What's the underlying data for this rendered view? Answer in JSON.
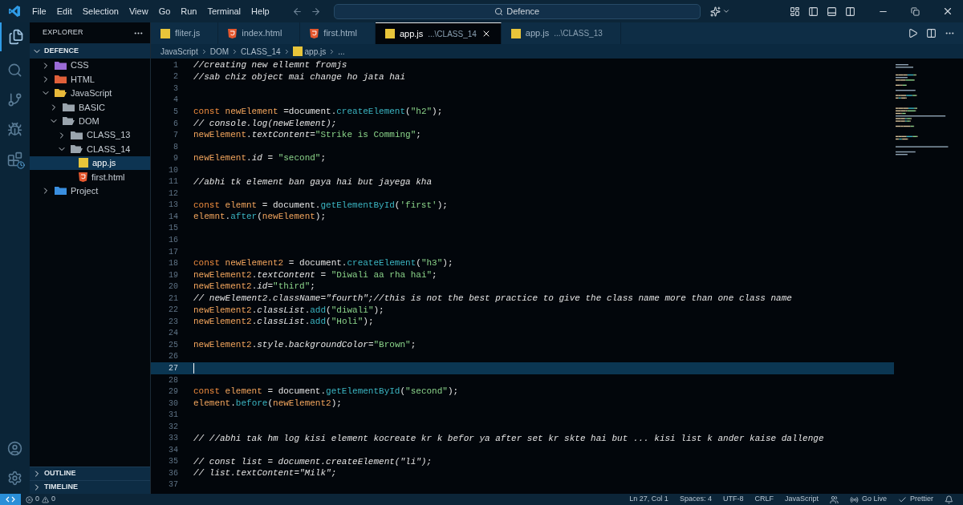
{
  "menu": [
    "File",
    "Edit",
    "Selection",
    "View",
    "Go",
    "Run",
    "Terminal",
    "Help"
  ],
  "search": {
    "value": "Defence"
  },
  "sidebar": {
    "title": "EXPLORER",
    "section": {
      "label": "DEFENCE",
      "expanded": true
    },
    "tree": [
      {
        "label": "CSS",
        "kind": "folder",
        "color": "#9b6bd6",
        "expanded": false,
        "selected": false
      },
      {
        "label": "HTML",
        "kind": "folder",
        "color": "#e0603a",
        "expanded": false,
        "selected": false
      },
      {
        "label": "JavaScript",
        "kind": "folder",
        "color": "#e8b93a",
        "expanded": true,
        "selected": false,
        "children": [
          {
            "label": "BASIC",
            "kind": "folder",
            "color": "#9aa4ad",
            "expanded": false,
            "selected": false
          },
          {
            "label": "DOM",
            "kind": "folder",
            "color": "#9aa4ad",
            "expanded": true,
            "selected": false,
            "children": [
              {
                "label": "CLASS_13",
                "kind": "folder",
                "color": "#9aa4ad",
                "expanded": false,
                "selected": false
              },
              {
                "label": "CLASS_14",
                "kind": "folder",
                "color": "#9aa4ad",
                "expanded": true,
                "selected": false,
                "children": [
                  {
                    "label": "app.js",
                    "kind": "js",
                    "selected": true
                  },
                  {
                    "label": "first.html",
                    "kind": "html",
                    "selected": false
                  }
                ]
              }
            ]
          }
        ]
      },
      {
        "label": "Project",
        "kind": "folder",
        "color": "#3a8fe0",
        "expanded": false,
        "selected": false
      }
    ],
    "panels": [
      {
        "label": "OUTLINE",
        "expanded": false
      },
      {
        "label": "TIMELINE",
        "expanded": false
      }
    ]
  },
  "tabs": [
    {
      "name": "fliter.js",
      "kind": "js",
      "selected": false
    },
    {
      "name": "index.html",
      "kind": "html",
      "selected": false
    },
    {
      "name": "first.html",
      "kind": "html",
      "selected": false
    },
    {
      "name": "app.js",
      "description": "...\\CLASS_14",
      "kind": "js",
      "selected": true
    },
    {
      "name": "app.js",
      "description": "...\\CLASS_13",
      "kind": "js",
      "selected": false
    }
  ],
  "breadcrumb": [
    {
      "label": "JavaScript",
      "kind": "text"
    },
    {
      "label": "DOM",
      "kind": "text"
    },
    {
      "label": "CLASS_14",
      "kind": "text"
    },
    {
      "label": "app.js",
      "kind": "js"
    },
    {
      "label": "...",
      "kind": "text"
    }
  ],
  "editor": {
    "lines": [
      {
        "number": "1",
        "current": false,
        "tokens": [
          {
            "kind": "c",
            "text": "//creating new ellemnt fromjs"
          }
        ]
      },
      {
        "number": "2",
        "current": false,
        "tokens": [
          {
            "kind": "c",
            "text": "//sab chiz object mai change ho jata hai"
          }
        ]
      },
      {
        "number": "3",
        "current": false
      },
      {
        "number": "4",
        "current": false
      },
      {
        "number": "5",
        "current": false,
        "tokens": [
          {
            "kind": "k",
            "text": "const "
          },
          {
            "kind": "v",
            "text": "newElement "
          },
          {
            "kind": "p",
            "text": "=document."
          },
          {
            "kind": "m",
            "text": "createElement"
          },
          {
            "kind": "p",
            "text": "("
          },
          {
            "kind": "s",
            "text": "\"h2\""
          },
          {
            "kind": "p",
            "text": ");"
          }
        ]
      },
      {
        "number": "6",
        "current": false,
        "tokens": [
          {
            "kind": "c",
            "text": "// console.log(newElement);"
          }
        ]
      },
      {
        "number": "7",
        "current": false,
        "tokens": [
          {
            "kind": "v",
            "text": "newElement"
          },
          {
            "kind": "p",
            "text": "."
          },
          {
            "kind": "i",
            "text": "textContent"
          },
          {
            "kind": "p",
            "text": "="
          },
          {
            "kind": "s",
            "text": "\"Strike is Comming\""
          },
          {
            "kind": "p",
            "text": ";"
          }
        ]
      },
      {
        "number": "8",
        "current": false
      },
      {
        "number": "9",
        "current": false,
        "tokens": [
          {
            "kind": "v",
            "text": "newElement"
          },
          {
            "kind": "p",
            "text": "."
          },
          {
            "kind": "i",
            "text": "id"
          },
          {
            "kind": "p",
            "text": " = "
          },
          {
            "kind": "s",
            "text": "\"second\""
          },
          {
            "kind": "p",
            "text": ";"
          }
        ]
      },
      {
        "number": "10",
        "current": false
      },
      {
        "number": "11",
        "current": false,
        "tokens": [
          {
            "kind": "c",
            "text": "//abhi tk element ban gaya hai but jayega kha"
          }
        ]
      },
      {
        "number": "12",
        "current": false
      },
      {
        "number": "13",
        "current": false,
        "tokens": [
          {
            "kind": "k",
            "text": "const "
          },
          {
            "kind": "v",
            "text": "elemnt"
          },
          {
            "kind": "p",
            "text": " = document."
          },
          {
            "kind": "m",
            "text": "getElementById"
          },
          {
            "kind": "p",
            "text": "("
          },
          {
            "kind": "s",
            "text": "'first'"
          },
          {
            "kind": "p",
            "text": ");"
          }
        ]
      },
      {
        "number": "14",
        "current": false,
        "tokens": [
          {
            "kind": "v",
            "text": "elemnt"
          },
          {
            "kind": "p",
            "text": "."
          },
          {
            "kind": "m",
            "text": "after"
          },
          {
            "kind": "p",
            "text": "("
          },
          {
            "kind": "v",
            "text": "newElement"
          },
          {
            "kind": "p",
            "text": ");"
          }
        ]
      },
      {
        "number": "15",
        "current": false
      },
      {
        "number": "16",
        "current": false
      },
      {
        "number": "17",
        "current": false
      },
      {
        "number": "18",
        "current": false,
        "tokens": [
          {
            "kind": "k",
            "text": "const "
          },
          {
            "kind": "v",
            "text": "newElement2"
          },
          {
            "kind": "p",
            "text": " = document."
          },
          {
            "kind": "m",
            "text": "createElement"
          },
          {
            "kind": "p",
            "text": "("
          },
          {
            "kind": "s",
            "text": "\"h3\""
          },
          {
            "kind": "p",
            "text": ");"
          }
        ]
      },
      {
        "number": "19",
        "current": false,
        "tokens": [
          {
            "kind": "v",
            "text": "newElement2"
          },
          {
            "kind": "p",
            "text": "."
          },
          {
            "kind": "i",
            "text": "textContent"
          },
          {
            "kind": "p",
            "text": " = "
          },
          {
            "kind": "s",
            "text": "\"Diwali aa rha hai\""
          },
          {
            "kind": "p",
            "text": ";"
          }
        ]
      },
      {
        "number": "20",
        "current": false,
        "tokens": [
          {
            "kind": "v",
            "text": "newElement2"
          },
          {
            "kind": "p",
            "text": "."
          },
          {
            "kind": "i",
            "text": "id"
          },
          {
            "kind": "p",
            "text": "="
          },
          {
            "kind": "s",
            "text": "\"third\""
          },
          {
            "kind": "p",
            "text": ";"
          }
        ]
      },
      {
        "number": "21",
        "current": false,
        "tokens": [
          {
            "kind": "c",
            "text": "// newElement2.className=\"fourth\";//this is not the best practice to give the class name more than one class name"
          }
        ]
      },
      {
        "number": "22",
        "current": false,
        "tokens": [
          {
            "kind": "v",
            "text": "newElement2"
          },
          {
            "kind": "p",
            "text": "."
          },
          {
            "kind": "i",
            "text": "classList"
          },
          {
            "kind": "p",
            "text": "."
          },
          {
            "kind": "m",
            "text": "add"
          },
          {
            "kind": "p",
            "text": "("
          },
          {
            "kind": "s",
            "text": "\"diwali\""
          },
          {
            "kind": "p",
            "text": ");"
          }
        ]
      },
      {
        "number": "23",
        "current": false,
        "tokens": [
          {
            "kind": "v",
            "text": "newElement2"
          },
          {
            "kind": "p",
            "text": "."
          },
          {
            "kind": "i",
            "text": "classList"
          },
          {
            "kind": "p",
            "text": "."
          },
          {
            "kind": "m",
            "text": "add"
          },
          {
            "kind": "p",
            "text": "("
          },
          {
            "kind": "s",
            "text": "\"Holi\""
          },
          {
            "kind": "p",
            "text": ");"
          }
        ]
      },
      {
        "number": "24",
        "current": false
      },
      {
        "number": "25",
        "current": false,
        "tokens": [
          {
            "kind": "v",
            "text": "newElement2"
          },
          {
            "kind": "p",
            "text": "."
          },
          {
            "kind": "i",
            "text": "style"
          },
          {
            "kind": "p",
            "text": "."
          },
          {
            "kind": "i",
            "text": "backgroundColor"
          },
          {
            "kind": "p",
            "text": "="
          },
          {
            "kind": "s",
            "text": "\"Brown\""
          },
          {
            "kind": "p",
            "text": ";"
          }
        ]
      },
      {
        "number": "26",
        "current": false
      },
      {
        "number": "27",
        "current": true
      },
      {
        "number": "28",
        "current": false
      },
      {
        "number": "29",
        "current": false,
        "tokens": [
          {
            "kind": "k",
            "text": "const "
          },
          {
            "kind": "v",
            "text": "element"
          },
          {
            "kind": "p",
            "text": " = document."
          },
          {
            "kind": "m",
            "text": "getElementById"
          },
          {
            "kind": "p",
            "text": "("
          },
          {
            "kind": "s",
            "text": "\"second\""
          },
          {
            "kind": "p",
            "text": ");"
          }
        ]
      },
      {
        "number": "30",
        "current": false,
        "tokens": [
          {
            "kind": "v",
            "text": "element"
          },
          {
            "kind": "p",
            "text": "."
          },
          {
            "kind": "m",
            "text": "before"
          },
          {
            "kind": "p",
            "text": "("
          },
          {
            "kind": "v",
            "text": "newElement2"
          },
          {
            "kind": "p",
            "text": ");"
          }
        ]
      },
      {
        "number": "31",
        "current": false
      },
      {
        "number": "32",
        "current": false
      },
      {
        "number": "33",
        "current": false,
        "tokens": [
          {
            "kind": "c",
            "text": "// //abhi tak hm log kisi element kocreate kr k befor ya after set kr skte hai but ... kisi list k ander kaise dallenge"
          }
        ]
      },
      {
        "number": "34",
        "current": false
      },
      {
        "number": "35",
        "current": false,
        "tokens": [
          {
            "kind": "c",
            "text": "// const list = document.createElement(\"li\");"
          }
        ]
      },
      {
        "number": "36",
        "current": false,
        "tokens": [
          {
            "kind": "c",
            "text": "// list.textContent=\"Milk\";"
          }
        ]
      },
      {
        "number": "37",
        "current": false
      }
    ]
  },
  "status_bar": {
    "errors": "0",
    "warnings": "0",
    "items": [
      {
        "kind": "text",
        "label": "Ln 27, Col 1"
      },
      {
        "kind": "text",
        "label": "Spaces: 4"
      },
      {
        "kind": "text",
        "label": "UTF-8"
      },
      {
        "kind": "text",
        "label": "CRLF"
      },
      {
        "kind": "text",
        "label": "JavaScript"
      },
      {
        "kind": "people"
      },
      {
        "kind": "live",
        "label": "Go Live"
      },
      {
        "kind": "check",
        "label": "Prettier"
      },
      {
        "kind": "bell"
      }
    ]
  }
}
